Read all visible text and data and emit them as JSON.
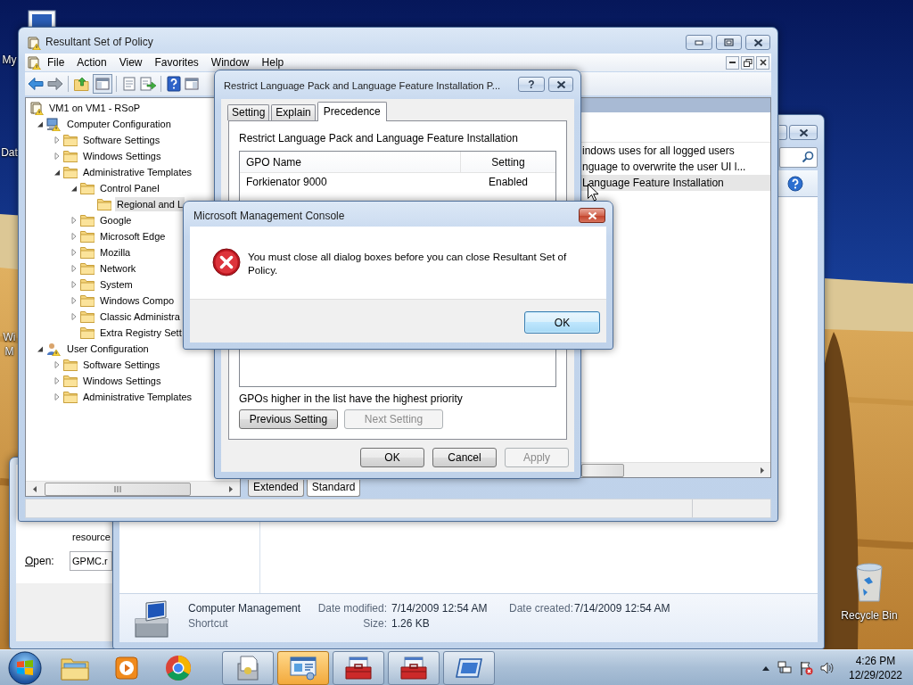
{
  "desktop": {
    "icons": [
      {
        "lines": [
          "My"
        ]
      },
      {
        "lines": [
          "Dat"
        ]
      },
      {
        "lines": [
          "Wi",
          "M"
        ]
      },
      {
        "lines": [
          "Recycle Bin"
        ]
      }
    ]
  },
  "run_dialog": {
    "text": "resource",
    "open_label": "Open:",
    "open_value": "GPMC.r"
  },
  "explorer": {
    "details": {
      "name": "Computer Management",
      "type": "Shortcut",
      "fields": [
        {
          "label": "Date modified:",
          "value": "7/14/2009 12:54 AM"
        },
        {
          "label": "Size:",
          "value": "1.26 KB"
        },
        {
          "label": "Date created:",
          "value": "7/14/2009 12:54 AM"
        }
      ]
    }
  },
  "rsop": {
    "title": "Resultant Set of Policy",
    "menu": [
      "File",
      "Action",
      "View",
      "Favorites",
      "Window",
      "Help"
    ],
    "tree": [
      {
        "label": "VM1 on VM1 - RSoP",
        "kind": "root",
        "selected": false,
        "children": [
          {
            "label": "Computer Configuration",
            "kind": "computer",
            "expanded": true,
            "selected": false,
            "children": [
              {
                "label": "Software Settings",
                "kind": "folder",
                "expanded": false,
                "selected": false
              },
              {
                "label": "Windows Settings",
                "kind": "folder",
                "expanded": false,
                "selected": false
              },
              {
                "label": "Administrative Templates",
                "kind": "folder",
                "expanded": true,
                "selected": false,
                "children": [
                  {
                    "label": "Control Panel",
                    "kind": "folder",
                    "expanded": true,
                    "selected": false,
                    "children": [
                      {
                        "label": "Regional and L",
                        "kind": "folder",
                        "selected": true
                      }
                    ]
                  },
                  {
                    "label": "Google",
                    "kind": "folder",
                    "expanded": false,
                    "selected": false
                  },
                  {
                    "label": "Microsoft Edge",
                    "kind": "folder",
                    "expanded": false,
                    "selected": false
                  },
                  {
                    "label": "Mozilla",
                    "kind": "folder",
                    "expanded": false,
                    "selected": false
                  },
                  {
                    "label": "Network",
                    "kind": "folder",
                    "expanded": false,
                    "selected": false
                  },
                  {
                    "label": "System",
                    "kind": "folder",
                    "expanded": false,
                    "selected": false
                  },
                  {
                    "label": "Windows Compo",
                    "kind": "folder",
                    "expanded": false,
                    "selected": false
                  },
                  {
                    "label": "Classic Administra",
                    "kind": "folder",
                    "expanded": false,
                    "selected": false
                  },
                  {
                    "label": "Extra Registry Sett",
                    "kind": "folder",
                    "selected": false
                  }
                ]
              }
            ]
          },
          {
            "label": "User Configuration",
            "kind": "user",
            "expanded": true,
            "selected": false,
            "children": [
              {
                "label": "Software Settings",
                "kind": "folder",
                "expanded": false,
                "selected": false
              },
              {
                "label": "Windows Settings",
                "kind": "folder",
                "expanded": false,
                "selected": false
              },
              {
                "label": "Administrative Templates",
                "kind": "folder",
                "expanded": false,
                "selected": false
              }
            ]
          }
        ]
      }
    ],
    "list_rows": [
      {
        "text": "indows uses for all logged users",
        "selected": false
      },
      {
        "text": "nguage to overwrite the user UI l...",
        "selected": false
      },
      {
        "text": "Language Feature Installation",
        "selected": true
      }
    ],
    "view_tabs": [
      {
        "label": "Extended",
        "selected": false
      },
      {
        "label": "Standard",
        "selected": true
      }
    ]
  },
  "policy_dialog": {
    "title": "Restrict Language Pack and Language Feature Installation P...",
    "help_button": "?",
    "tabs": [
      {
        "label": "Setting",
        "selected": false
      },
      {
        "label": "Explain",
        "selected": false
      },
      {
        "label": "Precedence",
        "selected": true
      }
    ],
    "heading": "Restrict Language Pack and Language Feature Installation",
    "table": {
      "columns": [
        "GPO Name",
        "Setting"
      ],
      "rows": [
        [
          "Forkienator 9000",
          "Enabled"
        ]
      ]
    },
    "note": "GPOs higher in the list have the highest priority",
    "nav_buttons": [
      {
        "label": "Previous Setting",
        "disabled": false
      },
      {
        "label": "Next Setting",
        "disabled": true
      }
    ],
    "buttons": [
      {
        "label": "OK",
        "disabled": false
      },
      {
        "label": "Cancel",
        "disabled": false
      },
      {
        "label": "Apply",
        "disabled": true
      }
    ]
  },
  "error_dialog": {
    "title": "Microsoft Management Console",
    "message": "You must close all dialog boxes before you can close Resultant Set of Policy.",
    "buttons": [
      {
        "label": "OK",
        "default": true
      }
    ]
  },
  "taskbar": {
    "buttons": [
      {
        "kind": "pinned",
        "flashing": false
      },
      {
        "kind": "pinned",
        "flashing": false
      },
      {
        "kind": "pinned",
        "flashing": false
      },
      {
        "kind": "running",
        "flashing": false
      },
      {
        "kind": "running",
        "flashing": true
      },
      {
        "kind": "running",
        "flashing": false
      },
      {
        "kind": "running",
        "flashing": false
      },
      {
        "kind": "running",
        "flashing": false
      }
    ],
    "time": "4:26 PM",
    "date": "12/29/2022"
  }
}
